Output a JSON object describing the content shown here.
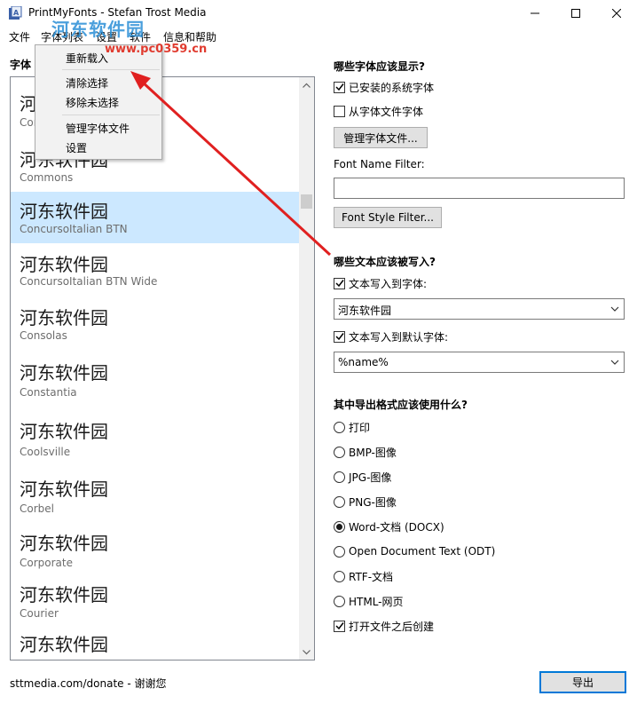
{
  "window": {
    "title": "PrintMyFonts - Stefan Trost Media"
  },
  "watermark": {
    "site_name": "河东软件园",
    "url": "www.pc0359.cn"
  },
  "menubar": {
    "items": [
      "文件",
      "字体列表",
      "设置",
      "软件",
      "信息和帮助"
    ]
  },
  "context_menu": {
    "items": [
      "重新载入",
      "清除选择",
      "移除未选择",
      "管理字体文件",
      "设置"
    ]
  },
  "font_list": {
    "header": "字体",
    "sample_text": "河东软件园",
    "fonts": [
      {
        "name": "Cor",
        "selected": false
      },
      {
        "name": "Commons",
        "selected": false
      },
      {
        "name": "ConcursoItalian BTN",
        "selected": true
      },
      {
        "name": "ConcursoItalian BTN Wide",
        "selected": false
      },
      {
        "name": "Consolas",
        "selected": false
      },
      {
        "name": "Constantia",
        "selected": false
      },
      {
        "name": "Coolsville",
        "selected": false
      },
      {
        "name": "Corbel",
        "selected": false
      },
      {
        "name": "Corporate",
        "selected": false
      },
      {
        "name": "Courier",
        "selected": false
      },
      {
        "name": "",
        "selected": false
      }
    ]
  },
  "display": {
    "title": "哪些字体应该显示?",
    "installed_label": "已安装的系统字体",
    "installed_checked": true,
    "from_files_label": "从字体文件字体",
    "from_files_checked": false,
    "manage_button": "管理字体文件...",
    "filter_label": "Font Name Filter:",
    "filter_value": "",
    "style_filter_button": "Font Style Filter..."
  },
  "text_write": {
    "title": "哪些文本应该被写入?",
    "to_font_label": "文本写入到字体:",
    "to_font_checked": true,
    "to_font_value": "河东软件园",
    "to_default_label": "文本写入到默认字体:",
    "to_default_checked": true,
    "to_default_value": "%name%"
  },
  "export_format": {
    "title": "其中导出格式应该使用什么?",
    "options": [
      "打印",
      "BMP-图像",
      "JPG-图像",
      "PNG-图像",
      "Word-文档 (DOCX)",
      "Open Document Text (ODT)",
      "RTF-文档",
      "HTML-网页"
    ],
    "selected": "Word-文档 (DOCX)",
    "open_after_label": "打开文件之后创建",
    "open_after_checked": true
  },
  "footer": {
    "donate_text": "sttmedia.com/donate - 谢谢您",
    "export_button": "导出"
  },
  "colors": {
    "selection": "#cce8ff",
    "accent": "#0078d7",
    "arrow": "#e02020"
  }
}
